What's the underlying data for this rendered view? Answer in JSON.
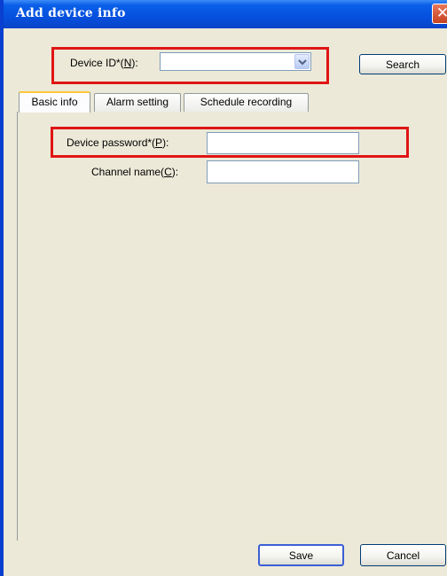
{
  "window": {
    "title": "Add device info",
    "close_symbol": "✕"
  },
  "device": {
    "id_label_prefix": "Device ID*(",
    "id_label_key": "N",
    "id_label_suffix": "):",
    "id_value": "",
    "search_label": "Search"
  },
  "tabs": [
    {
      "label": "Basic info",
      "active": true
    },
    {
      "label": "Alarm setting",
      "active": false
    },
    {
      "label": "Schedule recording",
      "active": false
    }
  ],
  "basic": {
    "password_label_prefix": "Device password*(",
    "password_label_key": "P",
    "password_label_suffix": "):",
    "password_value": "",
    "channel_label_prefix": "Channel name(",
    "channel_label_key": "C",
    "channel_label_suffix": "):",
    "channel_value": ""
  },
  "footer": {
    "save_label": "Save",
    "cancel_label": "Cancel"
  },
  "colors": {
    "highlight": "#e01515",
    "titlebar": "#0550de",
    "tab_active_accent": "#ffc83c"
  }
}
